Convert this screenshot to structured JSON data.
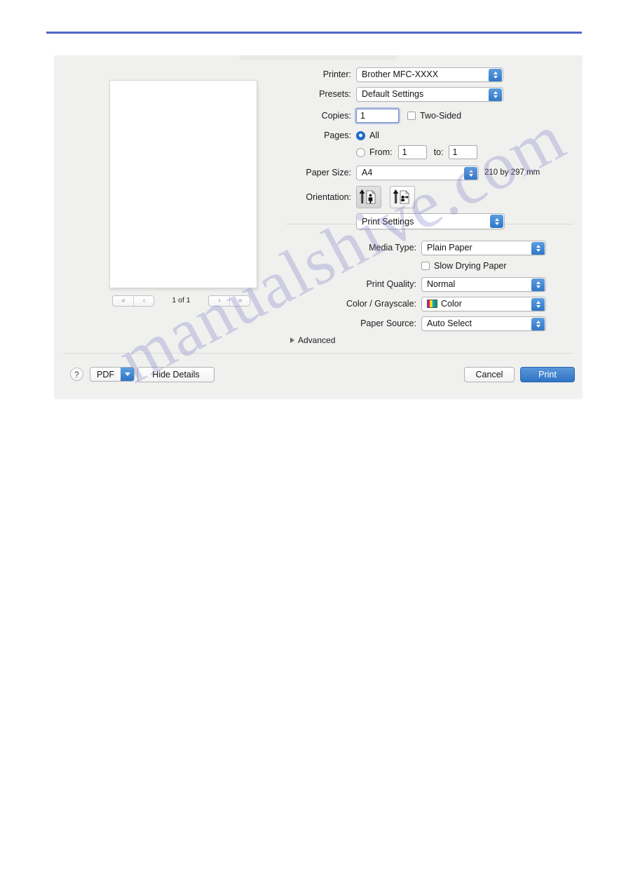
{
  "page": {
    "watermark": "manualshive.com",
    "rule_color": "#5168c4"
  },
  "dialog": {
    "preview": {
      "page_indicator": "1 of 1",
      "nav": {
        "first_label": "«",
        "prev_label": "‹",
        "next_label": "›",
        "last_label": "»"
      }
    },
    "fields": {
      "printer_label": "Printer:",
      "printer_value": "Brother MFC-XXXX",
      "presets_label": "Presets:",
      "presets_value": "Default Settings",
      "copies_label": "Copies:",
      "copies_value": "1",
      "two_sided_label": "Two-Sided",
      "two_sided_checked": false,
      "pages_label": "Pages:",
      "pages_all_label": "All",
      "pages_all_selected": true,
      "pages_from_label": "From:",
      "pages_from_value": "1",
      "pages_to_label": "to:",
      "pages_to_value": "1",
      "paper_size_label": "Paper Size:",
      "paper_size_value": "A4",
      "paper_size_hint": "210 by 297 mm",
      "orientation_label": "Orientation:",
      "orientation_portrait_selected": true
    },
    "panel": {
      "selector_value": "Print Settings",
      "media_type_label": "Media Type:",
      "media_type_value": "Plain Paper",
      "slow_drying_label": "Slow Drying Paper",
      "slow_drying_checked": false,
      "print_quality_label": "Print Quality:",
      "print_quality_value": "Normal",
      "color_grayscale_label": "Color / Grayscale:",
      "color_grayscale_value": "Color",
      "color_swatch": [
        "#e0127f",
        "#f2e500",
        "#00a0dd",
        "#00a651"
      ],
      "paper_source_label": "Paper Source:",
      "paper_source_value": "Auto Select",
      "advanced_label": "Advanced"
    },
    "buttons": {
      "help_label": "?",
      "pdf_label": "PDF",
      "details_label": "Hide Details",
      "cancel_label": "Cancel",
      "print_label": "Print"
    }
  }
}
